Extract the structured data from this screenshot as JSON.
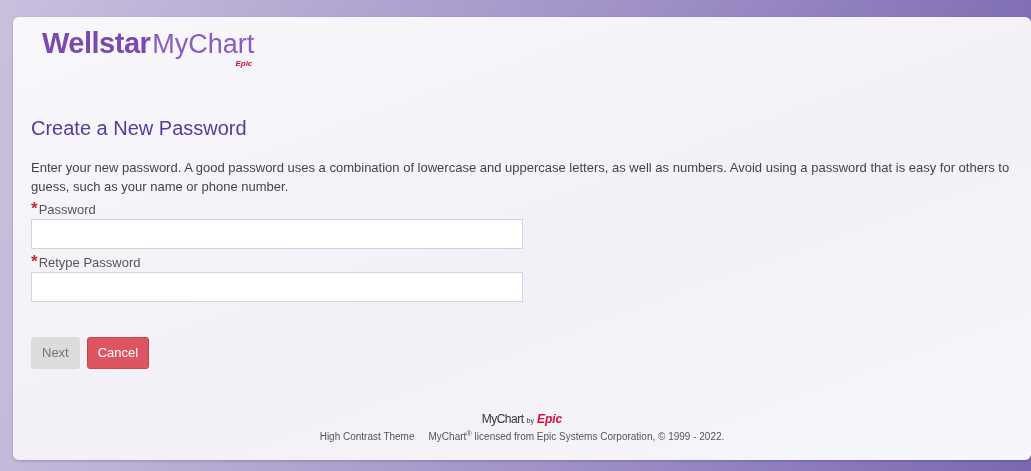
{
  "logo": {
    "brand": "Wellstar",
    "product": "MyChart",
    "vendor": "Epic"
  },
  "heading": "Create a New Password",
  "instructions": "Enter your new password. A good password uses a combination of lowercase and uppercase letters, as well as numbers. Avoid using a password that is easy for others to guess, such as your name or phone number.",
  "fields": [
    {
      "label": "Password",
      "required": true,
      "required_mark": "*"
    },
    {
      "label": "Retype Password",
      "required": true,
      "required_mark": "*"
    }
  ],
  "buttons": [
    {
      "label": "Next",
      "kind": "primary",
      "disabled": true
    },
    {
      "label": "Cancel",
      "kind": "danger",
      "disabled": false
    }
  ],
  "footer": {
    "logo_product": "MyChart",
    "logo_by": "by",
    "logo_vendor": "Epic",
    "links": [
      "High Contrast Theme"
    ],
    "copyright": "MyChart$^{®}$ licensed from Epic Systems Corporation, © 1999 - 2022."
  }
}
